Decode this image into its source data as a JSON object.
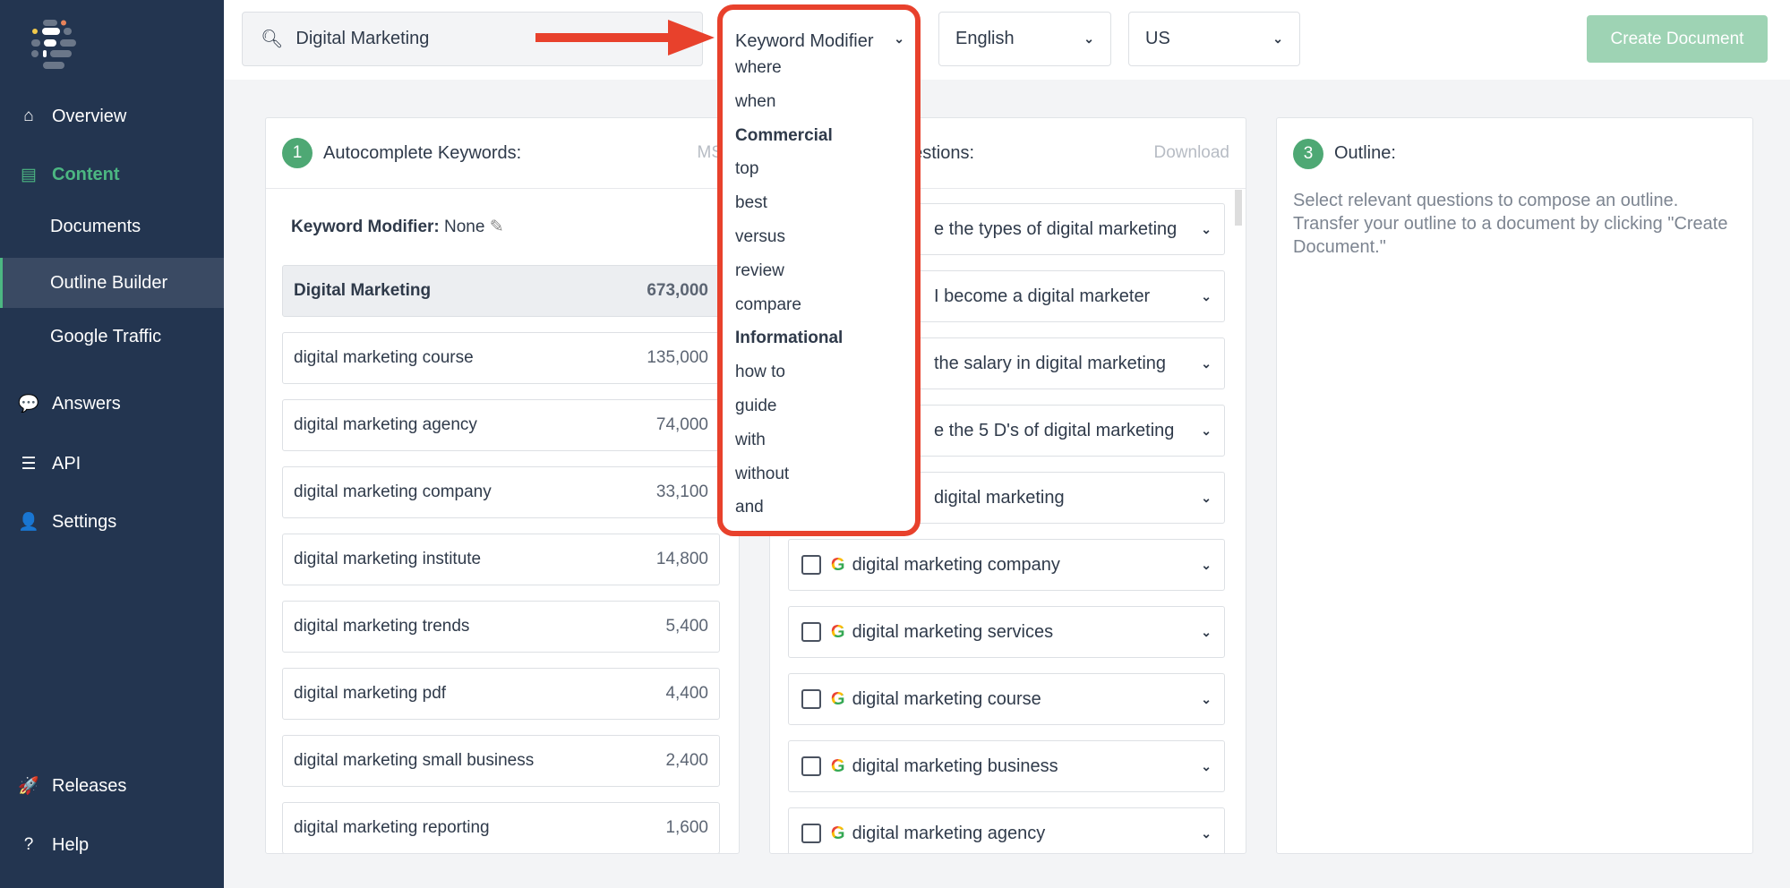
{
  "sidebar": {
    "items": [
      {
        "label": "Overview",
        "icon": "home-icon"
      },
      {
        "label": "Content",
        "icon": "document-icon"
      },
      {
        "label": "Documents"
      },
      {
        "label": "Outline Builder"
      },
      {
        "label": "Google Traffic"
      },
      {
        "label": "Answers",
        "icon": "chat-icon"
      },
      {
        "label": "API",
        "icon": "server-icon"
      },
      {
        "label": "Settings",
        "icon": "user-icon"
      },
      {
        "label": "Releases",
        "icon": "rocket-icon"
      },
      {
        "label": "Help",
        "icon": "help-icon"
      }
    ]
  },
  "topbar": {
    "search_value": "Digital Marketing",
    "modifier_select": "Keyword Modifier",
    "language_select": "English",
    "country_select": "US",
    "create_label": "Create Document"
  },
  "dropdown": {
    "options": [
      {
        "label": "where",
        "group": false
      },
      {
        "label": "when",
        "group": false
      },
      {
        "label": "Commercial",
        "group": true
      },
      {
        "label": "top",
        "group": false
      },
      {
        "label": "best",
        "group": false
      },
      {
        "label": "versus",
        "group": false
      },
      {
        "label": "review",
        "group": false
      },
      {
        "label": "compare",
        "group": false
      },
      {
        "label": "Informational",
        "group": true
      },
      {
        "label": "how to",
        "group": false
      },
      {
        "label": "guide",
        "group": false
      },
      {
        "label": "with",
        "group": false
      },
      {
        "label": "without",
        "group": false
      },
      {
        "label": "and",
        "group": false
      }
    ]
  },
  "panel1": {
    "number": "1",
    "title": "Autocomplete Keywords:",
    "right": "MS",
    "modifier_label": "Keyword Modifier:",
    "modifier_value": "None",
    "keywords": [
      {
        "k": "Digital Marketing",
        "v": "673,000"
      },
      {
        "k": "digital marketing course",
        "v": "135,000"
      },
      {
        "k": "digital marketing agency",
        "v": "74,000"
      },
      {
        "k": "digital marketing company",
        "v": "33,100"
      },
      {
        "k": "digital marketing institute",
        "v": "14,800"
      },
      {
        "k": "digital marketing trends",
        "v": "5,400"
      },
      {
        "k": "digital marketing pdf",
        "v": "4,400"
      },
      {
        "k": "digital marketing small business",
        "v": "2,400"
      },
      {
        "k": "digital marketing reporting",
        "v": "1,600"
      }
    ]
  },
  "panel2": {
    "title": "uestions:",
    "right": "Download",
    "questions": [
      "e the types of digital marketing",
      "I become a digital marketer",
      "the salary in digital marketing",
      "e the 5 D's of digital marketing",
      "digital marketing",
      "digital marketing company",
      "digital marketing services",
      "digital marketing course",
      "digital marketing business",
      "digital marketing agency"
    ]
  },
  "panel3": {
    "number": "3",
    "title": "Outline:",
    "text": "Select relevant questions to compose an outline. Transfer your outline to a document by clicking \"Create Document.\""
  },
  "colors": {
    "sidebar": "#233550",
    "accent": "#4cb782",
    "annotation": "#e8412c"
  }
}
